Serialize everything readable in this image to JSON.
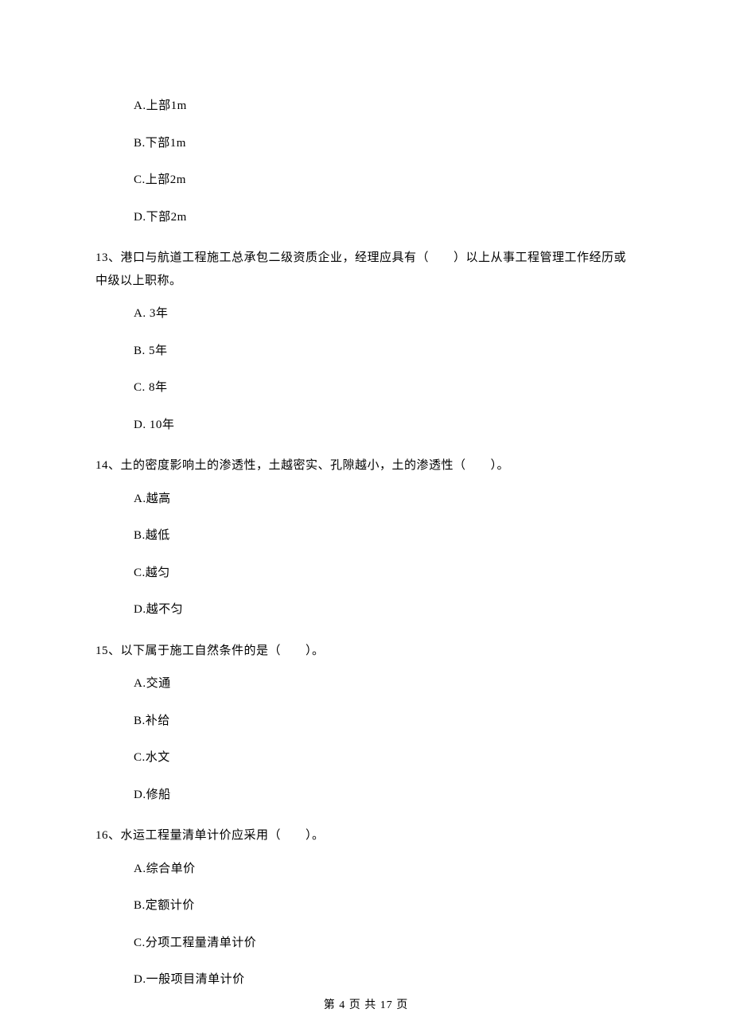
{
  "q12": {
    "A": "A.上部1m",
    "B": "B.下部1m",
    "C": "C.上部2m",
    "D": "D.下部2m"
  },
  "q13": {
    "stem": "13、港口与航道工程施工总承包二级资质企业，经理应具有（　　）以上从事工程管理工作经历或中级以上职称。",
    "A": "A. 3年",
    "B": "B. 5年",
    "C": "C. 8年",
    "D": "D. 10年"
  },
  "q14": {
    "stem": "14、土的密度影响土的渗透性，土越密实、孔隙越小，土的渗透性（　　）。",
    "A": "A.越高",
    "B": "B.越低",
    "C": "C.越匀",
    "D": "D.越不匀"
  },
  "q15": {
    "stem": "15、以下属于施工自然条件的是（　　）。",
    "A": "A.交通",
    "B": "B.补给",
    "C": "C.水文",
    "D": "D.修船"
  },
  "q16": {
    "stem": "16、水运工程量清单计价应采用（　　）。",
    "A": "A.综合单价",
    "B": "B.定额计价",
    "C": "C.分项工程量清单计价",
    "D": "D.一般项目清单计价"
  },
  "footer": "第 4 页 共 17 页"
}
